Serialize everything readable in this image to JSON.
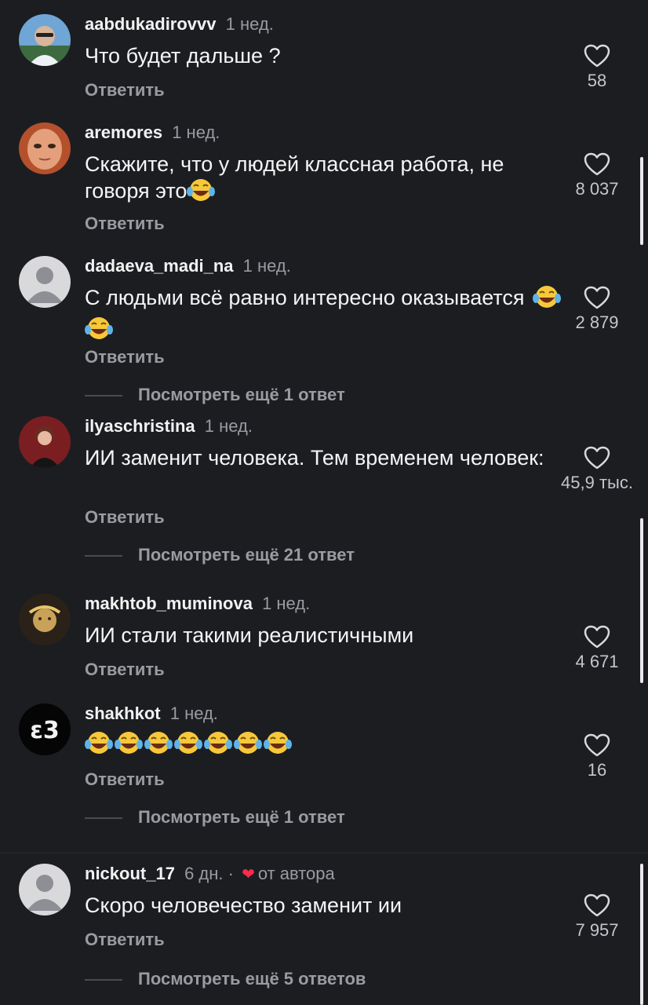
{
  "reply_label": "Ответить",
  "colors": {
    "background": "#1c1d21",
    "muted": "#9a9ba1",
    "heart": "#ff2a4a"
  },
  "comments": [
    {
      "username": "aabdukadirovvv",
      "time": "1 нед.",
      "text": "Что будет дальше ?",
      "likes": "58"
    },
    {
      "username": "aremores",
      "time": "1 нед.",
      "text": "Скажите, что у людей классная работа, не говоря это",
      "likes": "8 037"
    },
    {
      "username": "dadaeva_madi_na",
      "time": "1 нед.",
      "text": "С людьми всё равно интересно оказывается",
      "likes": "2 879",
      "more": "Посмотреть ещё 1 ответ"
    },
    {
      "username": "ilyaschristina",
      "time": "1 нед.",
      "text": "ИИ заменит человека. Тем временем человек:",
      "likes": "45,9 тыс.",
      "more": "Посмотреть ещё 21 ответ"
    },
    {
      "username": "makhtob_muminova",
      "time": "1 нед.",
      "text": "ИИ стали такими реалистичными",
      "likes": "4 671"
    },
    {
      "username": "shakhkot",
      "time": "1 нед.",
      "text": "",
      "likes": "16",
      "more": "Посмотреть ещё 1 ответ"
    },
    {
      "username": "nickout_17",
      "time": "6 дн. ·",
      "author_note": "от автора",
      "text": "Скоро человечество заменит ии",
      "likes": "7 957",
      "more": "Посмотреть ещё 5 ответов"
    }
  ]
}
